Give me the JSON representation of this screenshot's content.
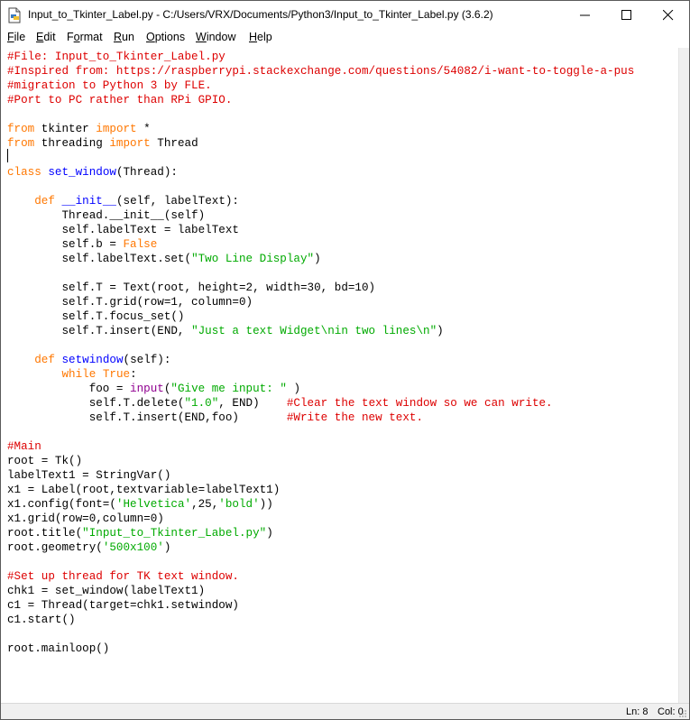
{
  "window": {
    "title": "Input_to_Tkinter_Label.py - C:/Users/VRX/Documents/Python3/Input_to_Tkinter_Label.py (3.6.2)",
    "icon": "idle-file-icon"
  },
  "menubar": {
    "items": [
      {
        "underline": "F",
        "rest": "ile"
      },
      {
        "underline": "E",
        "rest": "dit"
      },
      {
        "before": "F",
        "underline": "o",
        "rest": "rmat"
      },
      {
        "underline": "R",
        "rest": "un"
      },
      {
        "underline": "O",
        "rest": "ptions"
      },
      {
        "underline": "W",
        "rest": "indow"
      },
      {
        "underline": "H",
        "rest": "elp"
      }
    ]
  },
  "editor": {
    "lines": [
      [
        [
          "comment",
          "#File: Input_to_Tkinter_Label.py"
        ]
      ],
      [
        [
          "comment",
          "#Inspired from: https://raspberrypi.stackexchange.com/questions/54082/i-want-to-toggle-a-pus"
        ]
      ],
      [
        [
          "comment",
          "#migration to Python 3 by FLE."
        ]
      ],
      [
        [
          "comment",
          "#Port to PC rather than RPi GPIO."
        ]
      ],
      [],
      [
        [
          "kw",
          "from"
        ],
        [
          "",
          " tkinter "
        ],
        [
          "kw",
          "import"
        ],
        [
          "",
          " *"
        ]
      ],
      [
        [
          "kw",
          "from"
        ],
        [
          "",
          " threading "
        ],
        [
          "kw",
          "import"
        ],
        [
          "",
          " Thread"
        ]
      ],
      [],
      [
        [
          "kw",
          "class"
        ],
        [
          "",
          " "
        ],
        [
          "def",
          "set_window"
        ],
        [
          "",
          "(Thread):"
        ]
      ],
      [],
      [
        [
          "",
          "    "
        ],
        [
          "kw",
          "def"
        ],
        [
          "",
          " "
        ],
        [
          "def",
          "__init__"
        ],
        [
          "",
          "(self, labelText):"
        ]
      ],
      [
        [
          "",
          "        Thread.__init__(self)"
        ]
      ],
      [
        [
          "",
          "        self.labelText = labelText"
        ]
      ],
      [
        [
          "",
          "        self.b = "
        ],
        [
          "kw",
          "False"
        ]
      ],
      [
        [
          "",
          "        self.labelText.set("
        ],
        [
          "str",
          "\"Two Line Display\""
        ],
        [
          "",
          ")"
        ]
      ],
      [],
      [
        [
          "",
          "        self.T = Text(root, height=2, width=30, bd=10)"
        ]
      ],
      [
        [
          "",
          "        self.T.grid(row=1, column=0)"
        ]
      ],
      [
        [
          "",
          "        self.T.focus_set()"
        ]
      ],
      [
        [
          "",
          "        self.T.insert(END, "
        ],
        [
          "str",
          "\"Just a text Widget\\nin two lines\\n\""
        ],
        [
          "",
          ")"
        ]
      ],
      [],
      [
        [
          "",
          "    "
        ],
        [
          "kw",
          "def"
        ],
        [
          "",
          " "
        ],
        [
          "def",
          "setwindow"
        ],
        [
          "",
          "(self):"
        ]
      ],
      [
        [
          "",
          "        "
        ],
        [
          "kw",
          "while"
        ],
        [
          "",
          " "
        ],
        [
          "kw",
          "True"
        ],
        [
          "",
          ":"
        ]
      ],
      [
        [
          "",
          "            foo = "
        ],
        [
          "bi",
          "input"
        ],
        [
          "",
          "("
        ],
        [
          "str",
          "\"Give me input: \""
        ],
        [
          "",
          " )"
        ]
      ],
      [
        [
          "",
          "            self.T.delete("
        ],
        [
          "str",
          "\"1.0\""
        ],
        [
          "",
          ", END)    "
        ],
        [
          "comment",
          "#Clear the text window so we can write."
        ]
      ],
      [
        [
          "",
          "            self.T.insert(END,foo)       "
        ],
        [
          "comment",
          "#Write the new text."
        ]
      ],
      [],
      [
        [
          "comment",
          "#Main"
        ]
      ],
      [
        [
          "",
          "root = Tk()"
        ]
      ],
      [
        [
          "",
          "labelText1 = StringVar()"
        ]
      ],
      [
        [
          "",
          "x1 = Label(root,textvariable=labelText1)"
        ]
      ],
      [
        [
          "",
          "x1.config(font=("
        ],
        [
          "str",
          "'Helvetica'"
        ],
        [
          "",
          ",25,"
        ],
        [
          "str",
          "'bold'"
        ],
        [
          "",
          "))"
        ]
      ],
      [
        [
          "",
          "x1.grid(row=0,column=0)"
        ]
      ],
      [
        [
          "",
          "root.title("
        ],
        [
          "str",
          "\"Input_to_Tkinter_Label.py\""
        ],
        [
          "",
          ")"
        ]
      ],
      [
        [
          "",
          "root.geometry("
        ],
        [
          "str",
          "'500x100'"
        ],
        [
          "",
          ")"
        ]
      ],
      [],
      [
        [
          "comment",
          "#Set up thread for TK text window."
        ]
      ],
      [
        [
          "",
          "chk1 = set_window(labelText1)"
        ]
      ],
      [
        [
          "",
          "c1 = Thread(target=chk1.setwindow)"
        ]
      ],
      [
        [
          "",
          "c1.start()"
        ]
      ],
      [],
      [
        [
          "",
          "root.mainloop()"
        ]
      ]
    ]
  },
  "statusbar": {
    "line": "Ln: 8",
    "col": "Col: 0"
  },
  "colors": {
    "comment": "#dd0000",
    "keyword": "#ff7700",
    "definition": "#0000ff",
    "string": "#00aa00",
    "builtin": "#900090"
  }
}
